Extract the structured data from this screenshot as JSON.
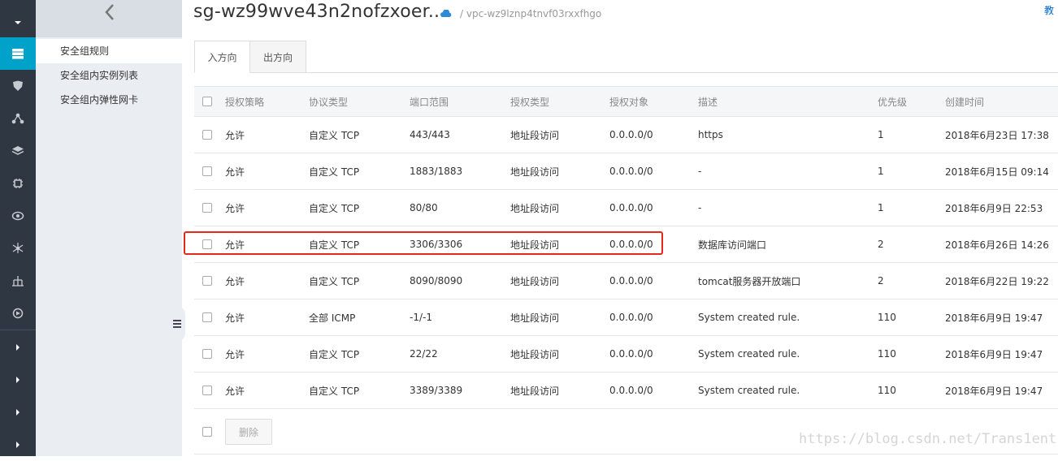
{
  "page": {
    "title": "sg-wz99wve43n2nofzxoer...",
    "vpc": "/ vpc-wz9lznp4tnvf03rxxfhgo",
    "top_right_link": "教"
  },
  "rail": {
    "items": [
      {
        "icon": "caret-down-icon"
      },
      {
        "icon": "server-icon"
      },
      {
        "icon": "shield-icon"
      },
      {
        "icon": "network-icon"
      },
      {
        "icon": "layers-icon"
      },
      {
        "icon": "chip-icon"
      },
      {
        "icon": "eye-icon"
      },
      {
        "icon": "hub-icon"
      },
      {
        "icon": "tree-icon"
      },
      {
        "icon": "circle-arrow-icon"
      },
      {
        "icon": "caret-right-icon"
      },
      {
        "icon": "caret-right-icon"
      },
      {
        "icon": "caret-right-icon"
      },
      {
        "icon": "caret-right-icon"
      }
    ],
    "accent": "#00a2ca",
    "background": "#2f3742"
  },
  "subnav": {
    "items": [
      {
        "label": "安全组规则"
      },
      {
        "label": "安全组内实例列表"
      },
      {
        "label": "安全组内弹性网卡"
      }
    ]
  },
  "tabs": [
    {
      "label": "入方向"
    },
    {
      "label": "出方向"
    }
  ],
  "table": {
    "headers": {
      "policy": "授权策略",
      "protocol": "协议类型",
      "port": "端口范围",
      "auth_type": "授权类型",
      "target": "授权对象",
      "desc": "描述",
      "priority": "优先级",
      "created": "创建时间"
    },
    "rows": [
      {
        "policy": "允许",
        "protocol": "自定义 TCP",
        "port": "443/443",
        "auth_type": "地址段访问",
        "target": "0.0.0.0/0",
        "desc": "https",
        "priority": "1",
        "created": "2018年6月23日 17:38"
      },
      {
        "policy": "允许",
        "protocol": "自定义 TCP",
        "port": "1883/1883",
        "auth_type": "地址段访问",
        "target": "0.0.0.0/0",
        "desc": "-",
        "priority": "1",
        "created": "2018年6月15日 09:14"
      },
      {
        "policy": "允许",
        "protocol": "自定义 TCP",
        "port": "80/80",
        "auth_type": "地址段访问",
        "target": "0.0.0.0/0",
        "desc": "-",
        "priority": "1",
        "created": "2018年6月9日 22:53"
      },
      {
        "policy": "允许",
        "protocol": "自定义 TCP",
        "port": "3306/3306",
        "auth_type": "地址段访问",
        "target": "0.0.0.0/0",
        "desc": "数据库访问端口",
        "priority": "2",
        "created": "2018年6月26日 14:26"
      },
      {
        "policy": "允许",
        "protocol": "自定义 TCP",
        "port": "8090/8090",
        "auth_type": "地址段访问",
        "target": "0.0.0.0/0",
        "desc": "tomcat服务器开放端口",
        "priority": "2",
        "created": "2018年6月22日 19:22"
      },
      {
        "policy": "允许",
        "protocol": "全部 ICMP",
        "port": "-1/-1",
        "auth_type": "地址段访问",
        "target": "0.0.0.0/0",
        "desc": "System created rule.",
        "priority": "110",
        "created": "2018年6月9日 19:47"
      },
      {
        "policy": "允许",
        "protocol": "自定义 TCP",
        "port": "22/22",
        "auth_type": "地址段访问",
        "target": "0.0.0.0/0",
        "desc": "System created rule.",
        "priority": "110",
        "created": "2018年6月9日 19:47"
      },
      {
        "policy": "允许",
        "protocol": "自定义 TCP",
        "port": "3389/3389",
        "auth_type": "地址段访问",
        "target": "0.0.0.0/0",
        "desc": "System created rule.",
        "priority": "110",
        "created": "2018年6月9日 19:47"
      }
    ],
    "delete_label": "删除"
  },
  "annotation": {
    "color": "#e8271b"
  },
  "watermark": "https://blog.csdn.net/Trans1ent"
}
